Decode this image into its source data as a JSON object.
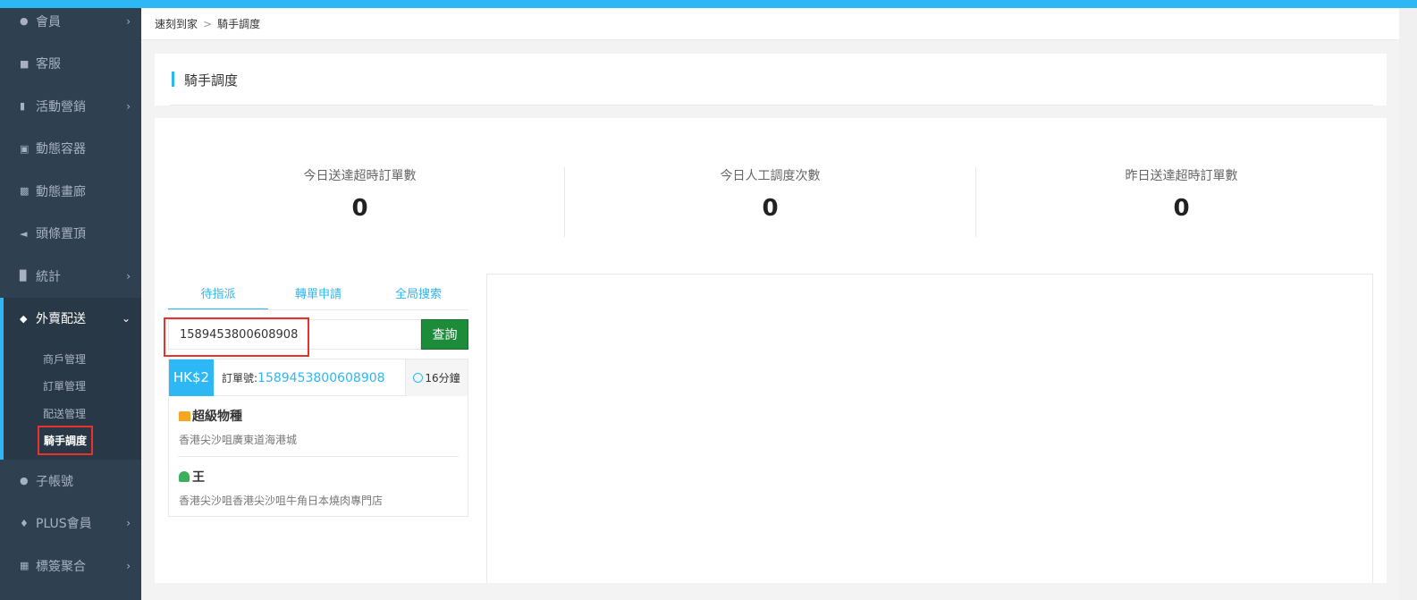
{
  "breadcrumb": {
    "home": "速刻到家",
    "separator": ">",
    "current": "騎手調度"
  },
  "sidebar": {
    "items": [
      {
        "label": "會員",
        "icon": "bell-icon",
        "has_arrow": true
      },
      {
        "label": "客服",
        "icon": "chat-icon",
        "has_arrow": false
      },
      {
        "label": "活動營銷",
        "icon": "bookmark-icon",
        "has_arrow": true
      },
      {
        "label": "動態容器",
        "icon": "inbox-icon",
        "has_arrow": false
      },
      {
        "label": "動態畫廊",
        "icon": "picture-icon",
        "has_arrow": false
      },
      {
        "label": "頭條置頂",
        "icon": "megaphone-icon",
        "has_arrow": false
      },
      {
        "label": "統計",
        "icon": "bar-chart-icon",
        "has_arrow": true
      },
      {
        "label": "外賣配送",
        "icon": "cutlery-icon",
        "has_arrow": true,
        "expanded": true
      }
    ],
    "submenu": [
      "商戶管理",
      "訂單管理",
      "配送管理",
      "騎手調度"
    ],
    "items_after": [
      {
        "label": "子帳號",
        "icon": "user-icon",
        "has_arrow": false
      },
      {
        "label": "PLUS會員",
        "icon": "diamond-icon",
        "has_arrow": true
      },
      {
        "label": "標簽聚合",
        "icon": "grid-icon",
        "has_arrow": true
      }
    ]
  },
  "page": {
    "title": "騎手調度"
  },
  "stats": [
    {
      "label": "今日送達超時訂單數",
      "value": "0"
    },
    {
      "label": "今日人工調度次數",
      "value": "0"
    },
    {
      "label": "昨日送達超時訂單數",
      "value": "0"
    }
  ],
  "tabs": [
    "待指派",
    "轉單申請",
    "全局搜索"
  ],
  "search": {
    "value": "1589453800608908",
    "button": "查詢"
  },
  "order": {
    "price": "HK$2",
    "number_label": "訂單號:",
    "number": "1589453800608908",
    "time": "16分鐘",
    "shop_name": "超級物種",
    "shop_address": "香港尖沙咀廣東道海港城",
    "customer_name": "王",
    "customer_address": "香港尖沙咀香港尖沙咀牛角日本燒肉專門店"
  },
  "colors": {
    "accent": "#2db7f5",
    "sidebar": "#2f4050",
    "search_button": "#1c8c3a",
    "highlight": "#e8322b"
  }
}
